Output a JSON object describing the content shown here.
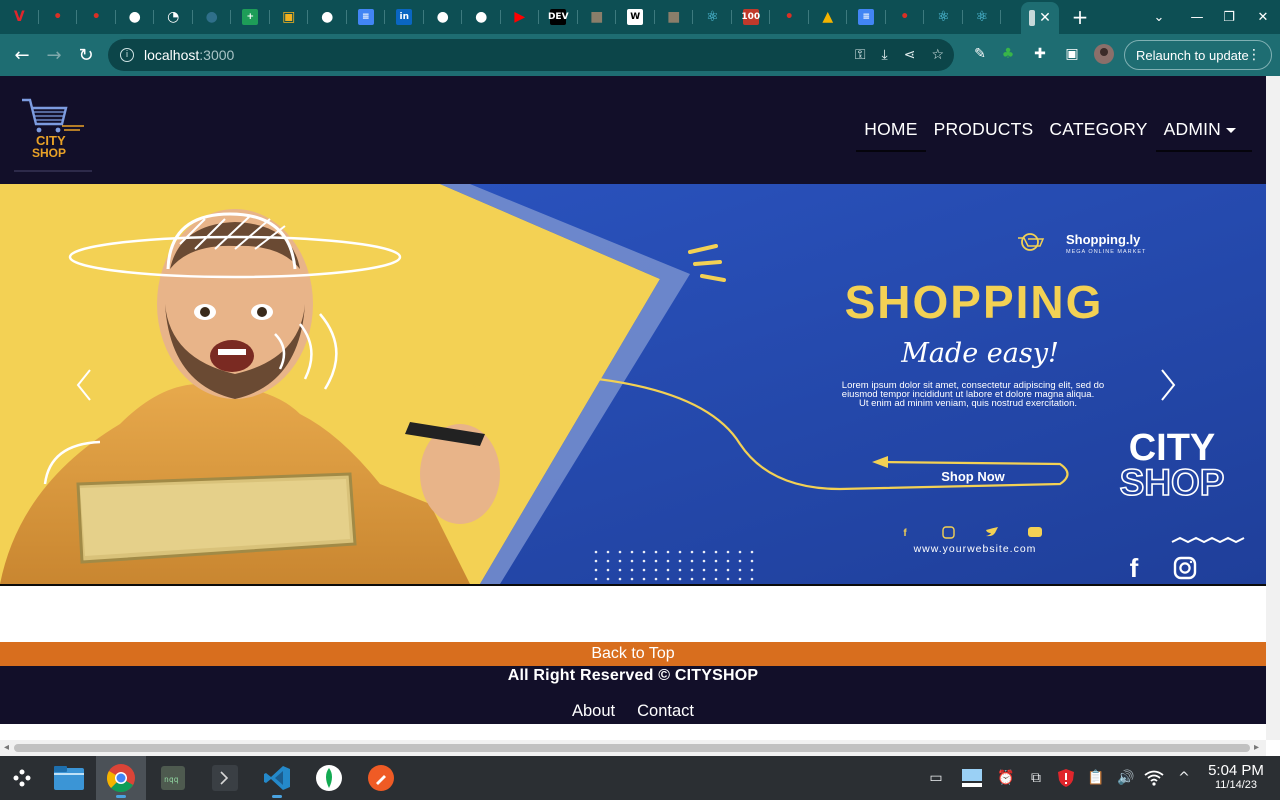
{
  "browser": {
    "tabs": [
      {
        "icon": "vivaldi-icon",
        "glyph": "V",
        "color": "#e0262c"
      },
      {
        "icon": "maps-pin-icon",
        "glyph": "•",
        "color": "#d93025"
      },
      {
        "icon": "maps-pin-icon",
        "glyph": "•",
        "color": "#d93025"
      },
      {
        "icon": "github-icon",
        "glyph": "●",
        "color": "#ffffff"
      },
      {
        "icon": "compass-icon",
        "glyph": "◔",
        "color": "#ffffff"
      },
      {
        "icon": "circle-app-icon",
        "glyph": "●",
        "color": "#2f6f8a"
      },
      {
        "icon": "google-sheets-icon",
        "glyph": "+",
        "color": "#1e9d58"
      },
      {
        "icon": "package-icon",
        "glyph": "▣",
        "color": "#f2b01e"
      },
      {
        "icon": "github-icon",
        "glyph": "●",
        "color": "#ffffff"
      },
      {
        "icon": "google-docs-icon",
        "glyph": "≡",
        "color": "#4285f4"
      },
      {
        "icon": "linkedin-icon",
        "glyph": "in",
        "color": "#0a66c2"
      },
      {
        "icon": "github-icon",
        "glyph": "●",
        "color": "#ffffff"
      },
      {
        "icon": "github-icon",
        "glyph": "●",
        "color": "#ffffff"
      },
      {
        "icon": "youtube-icon",
        "glyph": "▶",
        "color": "#ff0000"
      },
      {
        "icon": "dev-icon",
        "glyph": "DEV",
        "color": "#000000"
      },
      {
        "icon": "cat-avatar-icon",
        "glyph": "■",
        "color": "#8a7e6a"
      },
      {
        "icon": "wikipedia-icon",
        "glyph": "W",
        "color": "#ffffff"
      },
      {
        "icon": "cat-avatar-icon",
        "glyph": "■",
        "color": "#8a7e6a"
      },
      {
        "icon": "react-icon",
        "glyph": "⚛",
        "color": "#61dafb"
      },
      {
        "icon": "hundred-days-icon",
        "glyph": "100",
        "color": "#c0392b"
      },
      {
        "icon": "maps-pin-icon",
        "glyph": "•",
        "color": "#d93025"
      },
      {
        "icon": "google-drive-icon",
        "glyph": "▲",
        "color": "#f4b400"
      },
      {
        "icon": "google-docs-icon",
        "glyph": "≡",
        "color": "#4285f4"
      },
      {
        "icon": "maps-pin-icon",
        "glyph": "•",
        "color": "#d93025"
      },
      {
        "icon": "react-icon",
        "glyph": "⚛",
        "color": "#61dafb"
      },
      {
        "icon": "react-icon",
        "glyph": "⚛",
        "color": "#61dafb"
      }
    ],
    "url_host": "localhost",
    "url_port": ":3000",
    "relaunch_label": "Relaunch to update"
  },
  "site": {
    "brand_line1": "CITY",
    "brand_line2": "SHOP",
    "nav": {
      "home": "HOME",
      "products": "PRODUCTS",
      "category": "CATEGORY",
      "admin": "ADMIN"
    },
    "banner": {
      "brand": "Shopping.ly",
      "brand_tagline": "MEGA ONLINE MARKET",
      "headline": "SHOPPING",
      "script": "Made easy!",
      "body_1": "Lorem ipsum dolor sit amet, consectetur adipiscing elit, sed do",
      "body_2": "eiusmod tempor incididunt ut labore et dolore magna aliqua.",
      "body_3": "Ut enim ad minim veniam, quis nostrud exercitation.",
      "cta": "Shop Now",
      "city": "CITY",
      "shop": "SHOP",
      "website": "www.yourwebsite.com"
    },
    "back_to_top": "Back to Top",
    "copyright": "All Right Reserved © CITYSHOP",
    "footer_links": {
      "about": "About",
      "contact": "Contact"
    }
  },
  "taskbar": {
    "time": "5:04 PM",
    "date": "11/14/23"
  },
  "colors": {
    "chrome_dark": "#0d4f54",
    "chrome_toolbar": "#1e6d72",
    "site_nav": "#120f29",
    "accent_orange": "#d86e1e",
    "banner_blue": "#2a4fb3",
    "banner_yellow": "#f3d154"
  }
}
